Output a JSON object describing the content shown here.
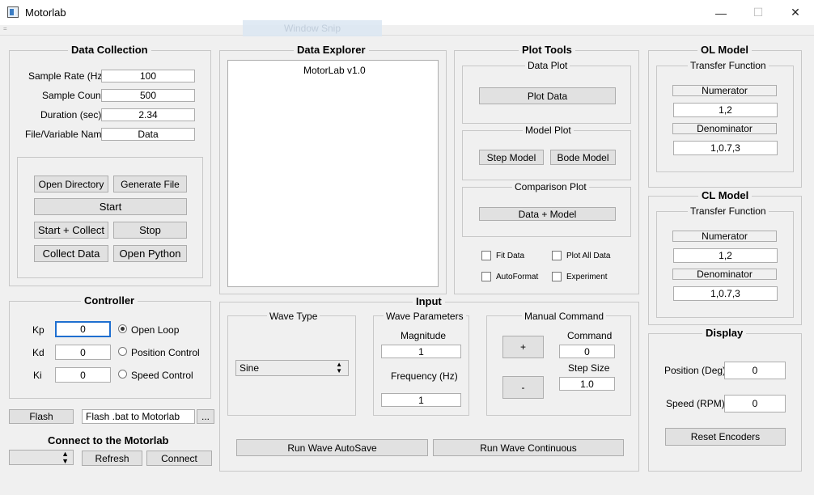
{
  "window": {
    "title": "Motorlab",
    "minimize": "—",
    "maximize": "☐",
    "close": "✕"
  },
  "overlay": {
    "snip": "Window Snip"
  },
  "data_collection": {
    "title": "Data Collection",
    "sample_rate_label": "Sample Rate (Hz)",
    "sample_rate": "100",
    "sample_count_label": "Sample Count",
    "sample_count": "500",
    "duration_label": "Duration (sec)",
    "duration": "2.34",
    "file_label": "File/Variable Name",
    "file": "Data",
    "open_directory": "Open Directory",
    "generate_file": "Generate File",
    "start": "Start",
    "start_collect": "Start + Collect",
    "stop": "Stop",
    "collect_data": "Collect Data",
    "open_python": "Open Python"
  },
  "controller": {
    "title": "Controller",
    "kp_label": "Kp",
    "kp": "0",
    "kd_label": "Kd",
    "kd": "0",
    "ki_label": "Ki",
    "ki": "0",
    "open_loop": "Open Loop",
    "position_control": "Position Control",
    "speed_control": "Speed Control"
  },
  "flash": {
    "button": "Flash",
    "path": "Flash .bat to Motorlab",
    "browse": "..."
  },
  "connect": {
    "title": "Connect to the Motorlab",
    "port": "",
    "refresh": "Refresh",
    "connect": "Connect"
  },
  "data_explorer": {
    "title": "Data Explorer",
    "items": [
      "MotorLab v1.0"
    ]
  },
  "plot_tools": {
    "title": "Plot Tools",
    "data_plot_title": "Data Plot",
    "plot_data": "Plot Data",
    "model_plot_title": "Model Plot",
    "step_model": "Step Model",
    "bode_model": "Bode Model",
    "comparison_title": "Comparison Plot",
    "data_model": "Data + Model",
    "fit_data": "Fit Data",
    "plot_all_data": "Plot All Data",
    "autoformat": "AutoFormat",
    "experiment": "Experiment"
  },
  "ol_model": {
    "title": "OL Model",
    "tf_title": "Transfer Function",
    "numerator_label": "Numerator",
    "numerator": "1,2",
    "denominator_label": "Denominator",
    "denominator": "1,0.7,3"
  },
  "cl_model": {
    "title": "CL Model",
    "tf_title": "Transfer Function",
    "numerator_label": "Numerator",
    "numerator": "1,2",
    "denominator_label": "Denominator",
    "denominator": "1,0.7,3"
  },
  "input": {
    "title": "Input",
    "wave_type_title": "Wave Type",
    "wave_type": "Sine",
    "wave_params_title": "Wave Parameters",
    "magnitude_label": "Magnitude",
    "magnitude": "1",
    "frequency_label": "Frequency (Hz)",
    "frequency": "1",
    "manual_title": "Manual Command",
    "plus": "+",
    "minus": "-",
    "command_label": "Command",
    "command": "0",
    "step_label": "Step Size",
    "step": "1.0",
    "run_autosave": "Run Wave AutoSave",
    "run_continuous": "Run Wave Continuous"
  },
  "display": {
    "title": "Display",
    "position_label": "Position (Deg)",
    "position": "0",
    "speed_label": "Speed (RPM)",
    "speed": "0",
    "reset": "Reset Encoders"
  }
}
